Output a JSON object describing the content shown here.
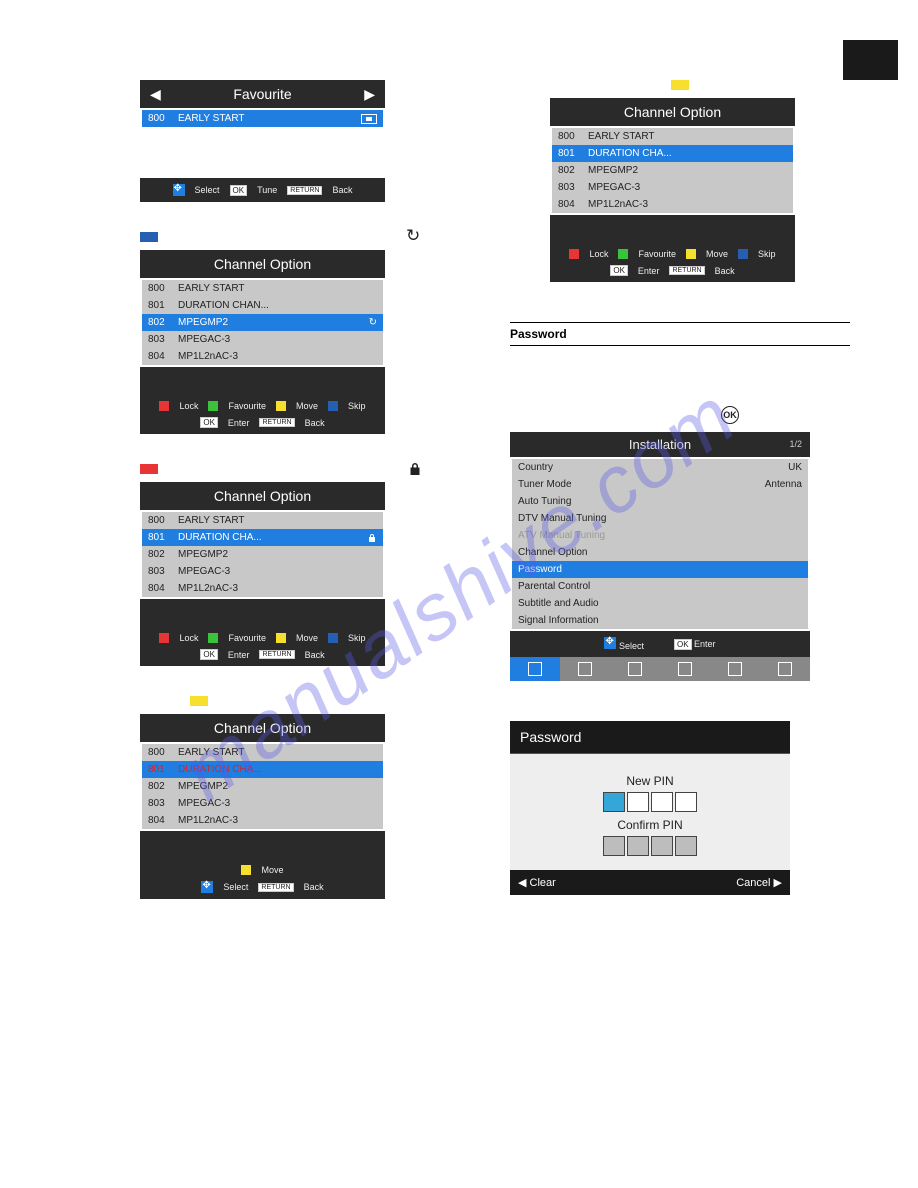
{
  "watermark": "manualshive.com",
  "favourite_panel": {
    "title": "Favourite",
    "rows": [
      {
        "num": "800",
        "name": "EARLY START",
        "selected": true
      }
    ],
    "hints": {
      "select": "Select",
      "tune": "Tune",
      "back": "Back"
    }
  },
  "channel_option": {
    "title": "Channel Option",
    "legend": {
      "lock": "Lock",
      "favourite": "Favourite",
      "move": "Move",
      "skip": "Skip"
    },
    "hints": {
      "enter": "Enter",
      "back": "Back",
      "select": "Select"
    }
  },
  "skip_panel_rows": [
    {
      "num": "800",
      "name": "EARLY START"
    },
    {
      "num": "801",
      "name": "DURATION CHAN..."
    },
    {
      "num": "802",
      "name": "MPEGMP2",
      "selected": true,
      "icon": "skip"
    },
    {
      "num": "803",
      "name": "MPEGAC-3"
    },
    {
      "num": "804",
      "name": "MP1L2nAC-3"
    }
  ],
  "lock_panel_rows": [
    {
      "num": "800",
      "name": "EARLY START"
    },
    {
      "num": "801",
      "name": "DURATION CHA...",
      "selected": true,
      "icon": "lock"
    },
    {
      "num": "802",
      "name": "MPEGMP2"
    },
    {
      "num": "803",
      "name": "MPEGAC-3"
    },
    {
      "num": "804",
      "name": "MP1L2nAC-3"
    }
  ],
  "move_panel_rows": [
    {
      "num": "800",
      "name": "EARLY START"
    },
    {
      "num": "801",
      "name": "DURATION CHA...",
      "selected": true,
      "redtext": true
    },
    {
      "num": "802",
      "name": "MPEGMP2"
    },
    {
      "num": "803",
      "name": "MPEGAC-3"
    },
    {
      "num": "804",
      "name": "MP1L2nAC-3"
    }
  ],
  "move_panel_hints": {
    "move": "Move",
    "select": "Select",
    "back": "Back"
  },
  "right_top_rows": [
    {
      "num": "800",
      "name": "EARLY START"
    },
    {
      "num": "801",
      "name": "DURATION CHA...",
      "selected": true
    },
    {
      "num": "802",
      "name": "MPEGMP2"
    },
    {
      "num": "803",
      "name": "MPEGAC-3"
    },
    {
      "num": "804",
      "name": "MP1L2nAC-3"
    }
  ],
  "password_heading": "Password",
  "installation": {
    "title": "Installation",
    "page": "1/2",
    "rows": [
      {
        "label": "Country",
        "value": "UK"
      },
      {
        "label": "Tuner Mode",
        "value": "Antenna"
      },
      {
        "label": "Auto Tuning",
        "value": ""
      },
      {
        "label": "DTV Manual Tuning",
        "value": ""
      },
      {
        "label": "ATV Manual Tuning",
        "value": "",
        "disabled": true
      },
      {
        "label": "Channel Option",
        "value": ""
      },
      {
        "label": "Password",
        "value": "",
        "selected": true
      },
      {
        "label": "Parental Control",
        "value": ""
      },
      {
        "label": "Subtitle and Audio",
        "value": ""
      },
      {
        "label": "Signal Information",
        "value": ""
      }
    ],
    "hints": {
      "select": "Select",
      "enter": "Enter"
    }
  },
  "password_dialog": {
    "title": "Password",
    "new_pin": "New PIN",
    "confirm_pin": "Confirm PIN",
    "clear": "Clear",
    "cancel": "Cancel"
  },
  "ok_label": "OK",
  "return_label": "RETURN"
}
